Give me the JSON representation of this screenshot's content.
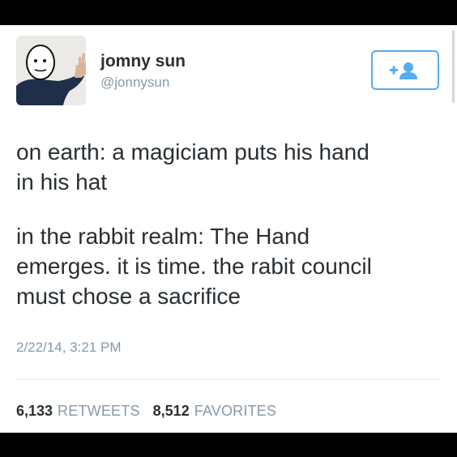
{
  "user": {
    "name": "jomny sun",
    "handle": "@jonnysun"
  },
  "follow_button": {
    "icon": "follow-user-icon",
    "color": "#55acee"
  },
  "tweet": {
    "paragraphs": [
      "on earth: a magiciam puts his hand\nin his hat",
      "in the rabbit realm: The Hand\nemerges. it is time. the rabit council\nmust chose a sacrifice"
    ],
    "timestamp": "2/22/14, 3:21 PM"
  },
  "stats": {
    "retweets_count": "6,133",
    "retweets_label": "RETWEETS",
    "favorites_count": "8,512",
    "favorites_label": "FAVORITES"
  },
  "colors": {
    "accent": "#55acee",
    "text": "#292f33",
    "muted": "#8899a6",
    "divider": "#e1e8ed"
  }
}
